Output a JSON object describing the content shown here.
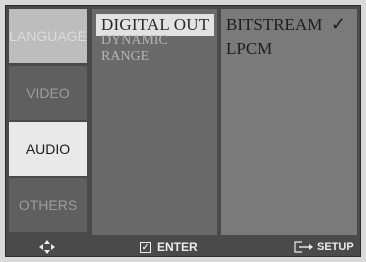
{
  "tabs": [
    {
      "label": "LANGUAGE",
      "state": "highlight"
    },
    {
      "label": "VIDEO",
      "state": "normal"
    },
    {
      "label": "AUDIO",
      "state": "selected"
    },
    {
      "label": "OTHERS",
      "state": "normal"
    }
  ],
  "menu": {
    "items": [
      {
        "label": "DIGITAL OUT",
        "state": "active"
      },
      {
        "label": "DYNAMIC RANGE",
        "state": "dim"
      }
    ]
  },
  "options": {
    "items": [
      {
        "label": "BITSTREAM",
        "checked": true
      },
      {
        "label": "LPCM",
        "checked": false
      }
    ],
    "check_glyph": "✓"
  },
  "footer": {
    "enter_label": "ENTER",
    "setup_label": "SETUP",
    "icons": [
      "navigate-icon",
      "enter-check-icon",
      "setup-arrow-icon"
    ]
  },
  "colors": {
    "frame": "#4a4a4a",
    "tab": "#5f5f5f",
    "tab_selected": "#e9e9e9",
    "menu_panel": "#6a6a6a",
    "options_panel": "#7a7a7a"
  }
}
